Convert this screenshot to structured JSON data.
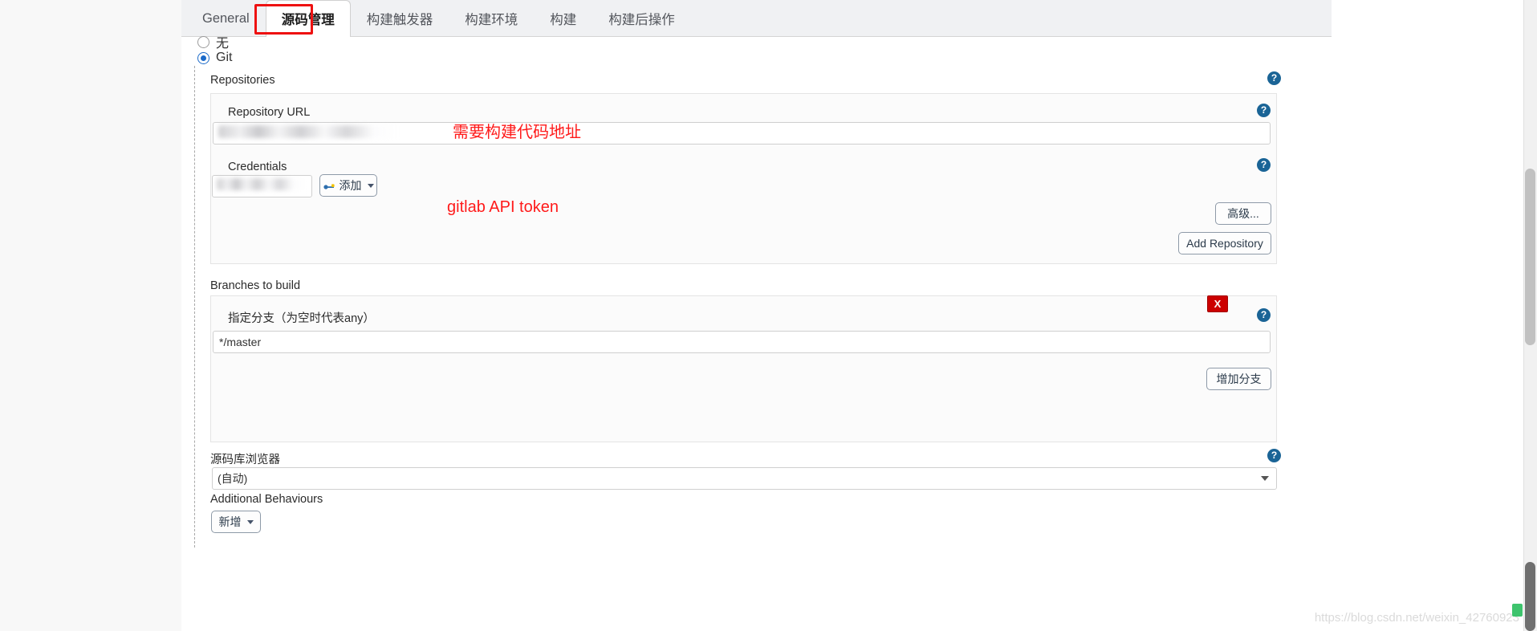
{
  "tabs": [
    {
      "label": "General",
      "active": false
    },
    {
      "label": "源码管理",
      "active": true
    },
    {
      "label": "构建触发器",
      "active": false
    },
    {
      "label": "构建环境",
      "active": false
    },
    {
      "label": "构建",
      "active": false
    },
    {
      "label": "构建后操作",
      "active": false
    }
  ],
  "scm": {
    "option_none": "无",
    "option_git": "Git",
    "selected": "Git"
  },
  "repositories": {
    "heading": "Repositories",
    "repository_url_label": "Repository URL",
    "repository_url_value": "",
    "repository_url_placeholder": "",
    "credentials_label": "Credentials",
    "credentials_value": "",
    "add_credentials_button": "添加",
    "advanced_button": "高级...",
    "add_repository_button": "Add Repository"
  },
  "branches": {
    "heading": "Branches to build",
    "branch_specifier_label": "指定分支（为空时代表any）",
    "branch_specifier_value": "*/master",
    "add_branch_button": "增加分支",
    "delete_button": "X"
  },
  "repository_browser": {
    "label": "源码库浏览器",
    "selected": "(自动)",
    "options": [
      "(自动)"
    ]
  },
  "additional_behaviours": {
    "label": "Additional Behaviours",
    "add_button": "新增"
  },
  "help": {
    "glyph": "?"
  },
  "annotations": [
    {
      "text": "需要构建代码地址"
    },
    {
      "text": "gitlab API token"
    }
  ],
  "watermark": {
    "text": "https://blog.csdn.net/weixin_42760923"
  },
  "colors": {
    "accent": "#1b6ac9",
    "help": "#1a6496",
    "danger": "#cc0000",
    "annotation": "#ff1a1a",
    "tab_highlight": "#ee1111"
  }
}
